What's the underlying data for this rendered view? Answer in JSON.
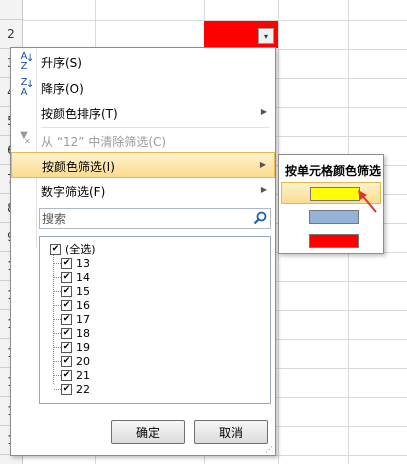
{
  "sheet": {
    "row_labels": [
      "",
      "2",
      "3",
      "4",
      "5",
      "6",
      "7",
      "8",
      "9",
      "1",
      "1",
      "1",
      "1",
      "1",
      "1",
      "1"
    ]
  },
  "filter_button": {
    "glyph": "▾"
  },
  "menu": {
    "items": [
      {
        "label": "升序(S)",
        "icon": "sort-ascending-icon",
        "icon_text": "A↓\nZ"
      },
      {
        "label": "降序(O)",
        "icon": "sort-descending-icon",
        "icon_text": "Z↓\nA"
      },
      {
        "label": "按颜色排序(T)",
        "icon": "",
        "icon_text": ""
      },
      {
        "label": "从 “12” 中清除筛选(C)",
        "icon": "clear-filter-icon",
        "icon_text": "✕"
      },
      {
        "label": "按颜色筛选(I)",
        "icon": "",
        "icon_text": ""
      },
      {
        "label": "数字筛选(F)",
        "icon": "",
        "icon_text": ""
      }
    ],
    "submenu_arrow": "▶",
    "search_placeholder": "搜索",
    "list": [
      "(全选)",
      "13",
      "14",
      "15",
      "16",
      "17",
      "18",
      "19",
      "20",
      "21",
      "22"
    ],
    "check_mark": "✔",
    "ok_label": "确定",
    "cancel_label": "取消",
    "resize_glyph": "⋰"
  },
  "submenu": {
    "title": "按单元格颜色筛选",
    "swatches": [
      {
        "color": "#ffff00",
        "name": "yellow"
      },
      {
        "color": "#95b3d7",
        "name": "blue"
      },
      {
        "color": "#ff0000",
        "name": "red"
      }
    ]
  },
  "colors": {
    "annotation_arrow": "#e2342b",
    "highlight": "#fbdc8e"
  }
}
